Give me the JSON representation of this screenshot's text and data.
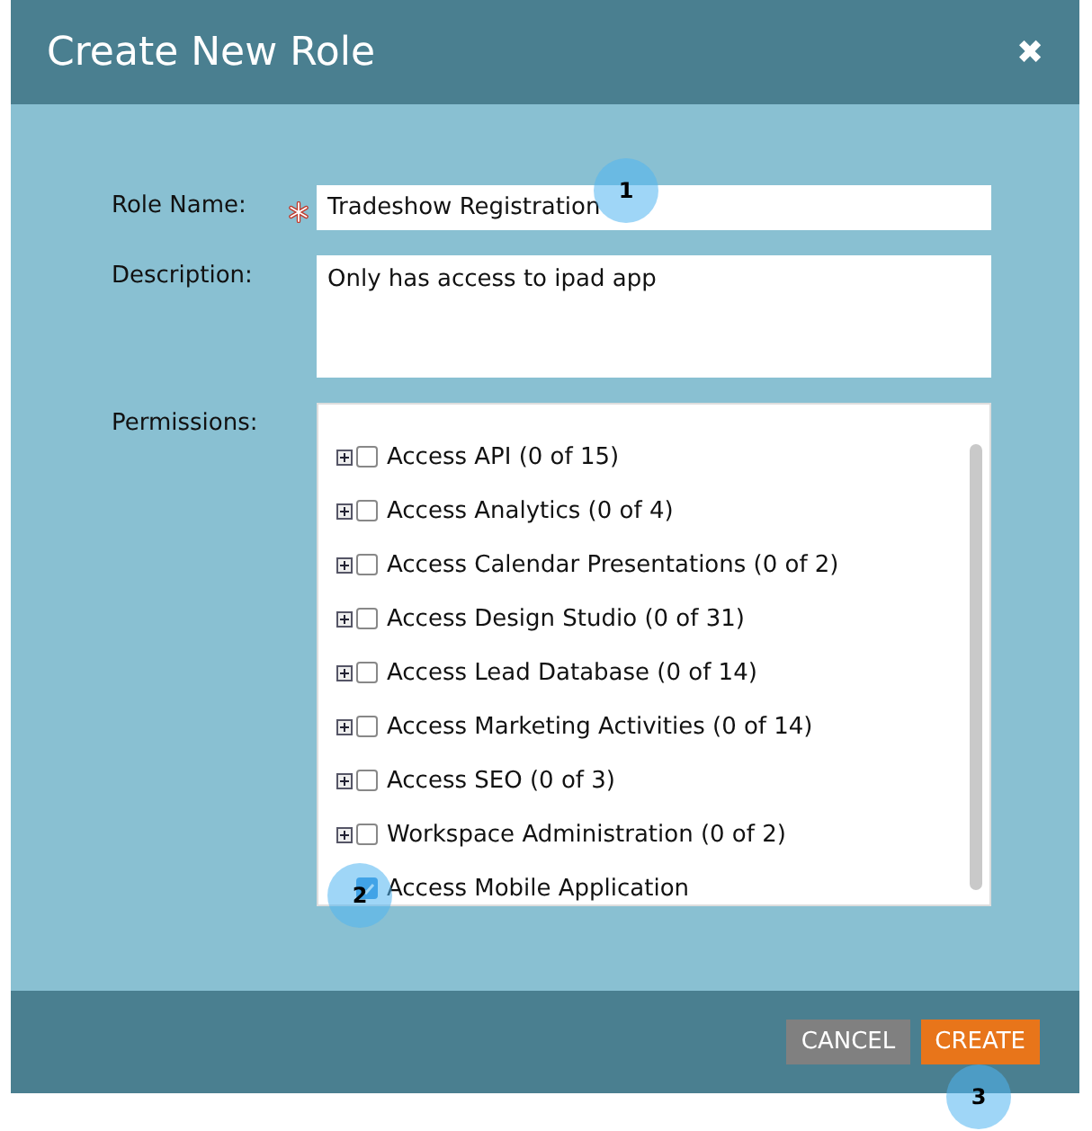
{
  "dialog": {
    "title": "Create New Role",
    "close_icon": "✖"
  },
  "fields": [
    {
      "label": "Role Name:",
      "required": true,
      "kind": "input",
      "value": "Tradeshow Registration"
    },
    {
      "label": "Description:",
      "required": false,
      "kind": "textarea",
      "value": "Only has access to ipad app"
    }
  ],
  "permissions": {
    "label": "Permissions:",
    "items": [
      {
        "label": "Access API (0 of 15)",
        "checked": false,
        "expandable": true
      },
      {
        "label": "Access Analytics (0 of 4)",
        "checked": false,
        "expandable": true
      },
      {
        "label": "Access Calendar Presentations (0 of 2)",
        "checked": false,
        "expandable": true
      },
      {
        "label": "Access Design Studio (0 of 31)",
        "checked": false,
        "expandable": true
      },
      {
        "label": "Access Lead Database (0 of 14)",
        "checked": false,
        "expandable": true
      },
      {
        "label": "Access Marketing Activities (0 of 14)",
        "checked": false,
        "expandable": true
      },
      {
        "label": "Access SEO (0 of 3)",
        "checked": false,
        "expandable": true
      },
      {
        "label": "Workspace Administration (0 of 2)",
        "checked": false,
        "expandable": true
      },
      {
        "label": "Access Mobile Application",
        "checked": true,
        "expandable": false
      }
    ]
  },
  "buttons": [
    {
      "label": "CANCEL",
      "kind": "secondary"
    },
    {
      "label": "CREATE",
      "kind": "primary"
    }
  ],
  "callouts": [
    {
      "number": "1"
    },
    {
      "number": "2"
    },
    {
      "number": "3"
    }
  ]
}
